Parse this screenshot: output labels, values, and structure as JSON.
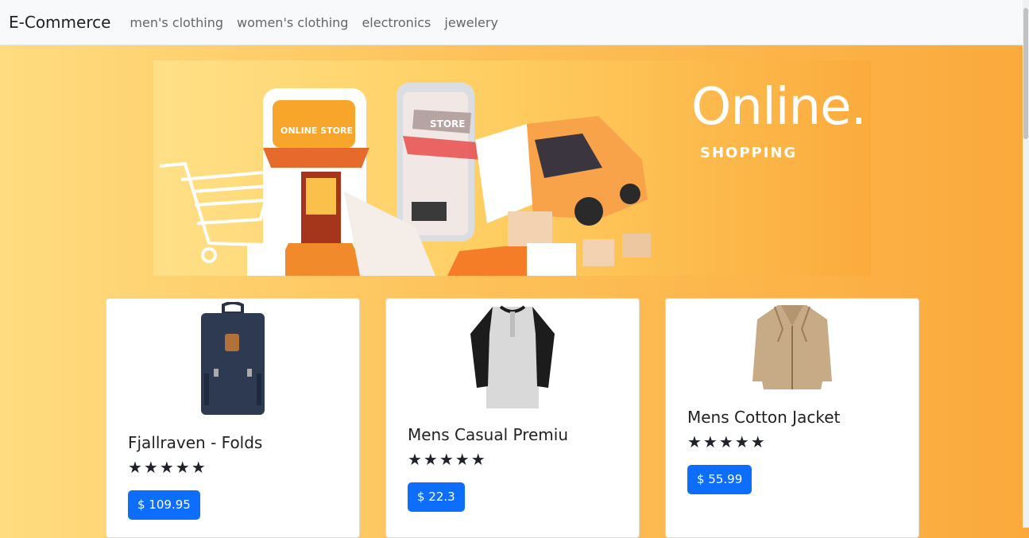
{
  "nav": {
    "brand": "E-Commerce",
    "links": [
      "men's clothing",
      "women's clothing",
      "electronics",
      "jewelery"
    ]
  },
  "banner": {
    "title": "Online.",
    "subtitle": "SHOPPING",
    "storefront_sign": "ONLINE STORE",
    "phone_sign": "STORE"
  },
  "products": [
    {
      "title": "Fjallraven - Folds",
      "rating_stars": "★★★★★",
      "price": "$ 109.95"
    },
    {
      "title": "Mens Casual Premiu",
      "rating_stars": "★★★★★",
      "price": "$ 22.3"
    },
    {
      "title": "Mens Cotton Jacket",
      "rating_stars": "★★★★★",
      "price": "$ 55.99"
    }
  ],
  "colors": {
    "primary": "#0d6efd",
    "navbar_bg": "#f8f9fa",
    "page_bg": "#fdc25a"
  }
}
